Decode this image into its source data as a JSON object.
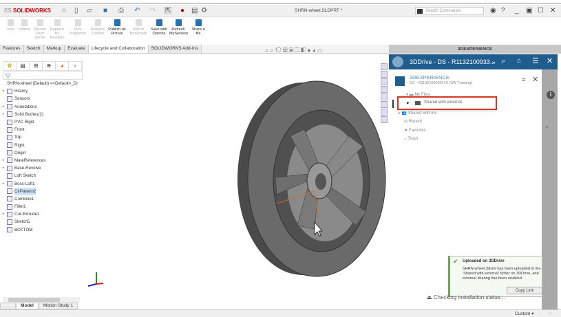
{
  "app": {
    "brand": "SOLIDWORKS",
    "document_title": "SHRN-wheel.SLDPRT *",
    "search_placeholder": "Search Commands"
  },
  "ribbon": {
    "buttons": [
      {
        "label": "Lock",
        "enabled": false
      },
      {
        "label": "Unlock",
        "enabled": false
      },
      {
        "label": "Reload From Server",
        "enabled": false
      },
      {
        "label": "Replace By Revision",
        "enabled": false
      },
      {
        "label": "PLM Properties",
        "enabled": false
      },
      {
        "label": "Replace Content",
        "enabled": false
      },
      {
        "label": "Publish as Picture",
        "enabled": true
      },
      {
        "label": "Add to Bookmark",
        "enabled": false
      },
      {
        "label": "Save with Options",
        "enabled": true
      },
      {
        "label": "Refresh MySession",
        "enabled": true
      },
      {
        "label": "Share a file",
        "enabled": true
      }
    ]
  },
  "tabs": [
    "Features",
    "Sketch",
    "Markup",
    "Evaluate",
    "Lifecycle and Collaboration",
    "SOLIDWORKS Add-Ins"
  ],
  "active_tab": "Lifecycle and Collaboration",
  "tree": {
    "root": "SHRN-wheel (Default) <<Default>_Di",
    "items": [
      {
        "label": "History",
        "expand": true
      },
      {
        "label": "Sensors",
        "expand": false
      },
      {
        "label": "Annotations",
        "expand": true
      },
      {
        "label": "Solid Bodies(2)",
        "expand": true
      },
      {
        "label": "PVC Rigid",
        "expand": false
      },
      {
        "label": "Front",
        "expand": false
      },
      {
        "label": "Top",
        "expand": false
      },
      {
        "label": "Right",
        "expand": false
      },
      {
        "label": "Origin",
        "expand": false
      },
      {
        "label": "MateReferences",
        "expand": true
      },
      {
        "label": "Base-Revolve",
        "expand": true
      },
      {
        "label": "Loft Sketch",
        "expand": false
      },
      {
        "label": "Boss-Loft1",
        "expand": true
      },
      {
        "label": "CirPattern2",
        "expand": false,
        "selected": true
      },
      {
        "label": "Combine1",
        "expand": false
      },
      {
        "label": "Fillet1",
        "expand": false
      },
      {
        "label": "Cut-Extrude1",
        "expand": true
      },
      {
        "label": "Sketch5",
        "expand": false
      },
      {
        "label": "BOTTOM",
        "expand": false
      }
    ]
  },
  "bottom_tabs": [
    "Model",
    "Motion Study 1"
  ],
  "status": {
    "units": "Custom"
  },
  "panel": {
    "header": "3DEXPERIENCE",
    "bar_title": "3DDrive - DS - R1132100933...",
    "tenant_title": "3DEXPERIENCE",
    "tenant_sub": "DS - R1132100933416 (SW Training)",
    "items": [
      "My Files",
      "Shared with external",
      "Shared with me",
      "Recent",
      "Favorites",
      "Trash"
    ],
    "highlighted": "Shared with external",
    "accent": "#1f5d8f"
  },
  "toast": {
    "title": "Uploaded on 3DDrive",
    "body": "SHRN-wheel.3dxml has been uploaded to the 'Shared with external' folder on 3DDrive, and external sharing has been enabled",
    "button": "Copy Link"
  },
  "checking": "Checking installation status..."
}
